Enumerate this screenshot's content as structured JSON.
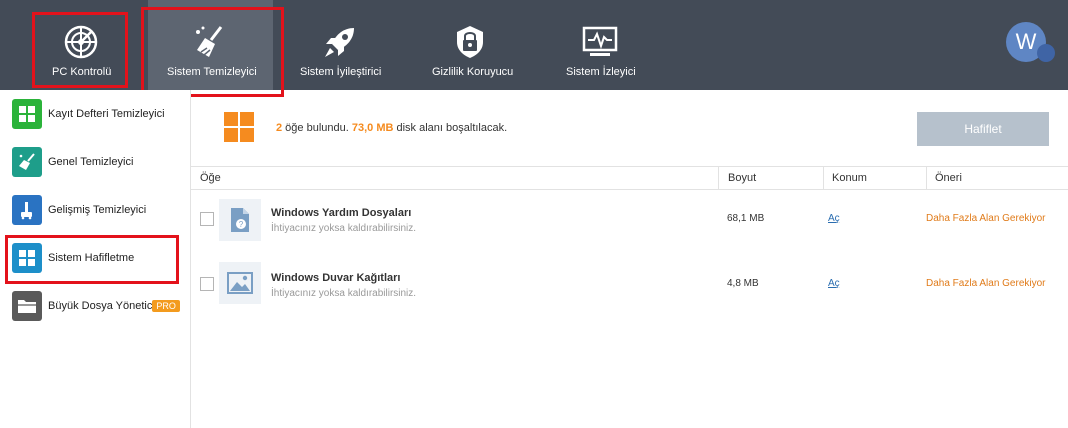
{
  "topbar": {
    "tabs": [
      {
        "label": "PC Kontrolü",
        "icon": "radar-icon"
      },
      {
        "label": "Sistem Temizleyici",
        "icon": "broom-icon"
      },
      {
        "label": "Sistem İyileştirici",
        "icon": "rocket-icon"
      },
      {
        "label": "Gizlilik Koruyucu",
        "icon": "lock-shield-icon"
      },
      {
        "label": "Sistem İzleyici",
        "icon": "monitor-pulse-icon"
      }
    ],
    "active_tab": "Sistem Temizleyici",
    "avatar_letter": "W"
  },
  "sidebar": {
    "items": [
      {
        "label": "Kayıt Defteri Temizleyici",
        "icon": "grid-icon",
        "color": "#2bb33a"
      },
      {
        "label": "Genel Temizleyici",
        "icon": "broom-icon",
        "color": "#1e9e8a"
      },
      {
        "label": "Gelişmiş Temizleyici",
        "icon": "vacuum-icon",
        "color": "#2a73c2"
      },
      {
        "label": "Sistem Hafifletme",
        "icon": "windows-icon",
        "color": "#1d8fc9"
      },
      {
        "label": "Büyük Dosya Yönetic",
        "icon": "folder-icon",
        "color": "#5a5a5a",
        "badge": "PRO"
      }
    ],
    "active_item": "Sistem Hafifletme"
  },
  "summary": {
    "count": "2",
    "count_text": " öğe bulundu. ",
    "size": "73,0 MB",
    "size_text": " disk alanı boşaltılacak."
  },
  "optimize_button": "Hafiflet",
  "table": {
    "headers": [
      "Öğe",
      "Boyut",
      "Konum",
      "Öneri"
    ],
    "rows": [
      {
        "title": "Windows Yardım Dosyaları",
        "subtitle": "İhtiyacınız yoksa kaldırabilirsiniz.",
        "size": "68,1 MB",
        "location": "Aç",
        "advice": "Daha Fazla Alan Gerekiyor",
        "icon": "help-file-icon"
      },
      {
        "title": "Windows Duvar Kağıtları",
        "subtitle": "İhtiyacınız yoksa kaldırabilirsiniz.",
        "size": "4,8 MB",
        "location": "Aç",
        "advice": "Daha Fazla Alan Gerekiyor",
        "icon": "image-icon"
      }
    ]
  },
  "colors": {
    "topbar": "#434b57",
    "active_tab": "#5d6571",
    "accent_orange": "#f58b1f",
    "highlight_red": "#e3121b"
  }
}
